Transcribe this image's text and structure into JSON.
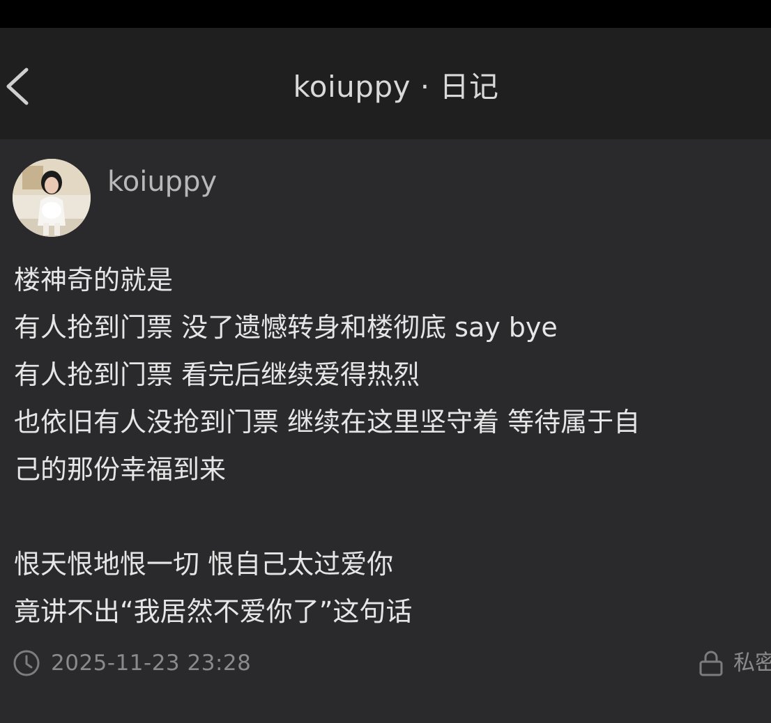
{
  "header": {
    "title": "koiuppy · 日记",
    "back_icon": "chevron-left-icon"
  },
  "author": {
    "name": "koiuppy",
    "avatar_icon": "user-avatar"
  },
  "diary": {
    "lines": [
      "楼神奇的就是",
      "有人抢到门票 没了遗憾转身和楼彻底 say bye",
      "有人抢到门票 看完后继续爱得热烈",
      "也依旧有人没抢到门票 继续在这里坚守着 等待属于自",
      "己的那份幸福到来",
      "",
      "恨天恨地恨一切 恨自己太过爱你",
      "竟讲不出“我居然不爱你了”这句话"
    ]
  },
  "meta": {
    "timestamp": "2025-11-23 23:28",
    "privacy_label": "私密",
    "clock_icon": "clock-icon",
    "lock_icon": "lock-icon"
  },
  "colors": {
    "background": "#2a2a2c",
    "nav_background": "#1f1f1f",
    "status_bar": "#000000",
    "primary_text": "#e6e6e6",
    "secondary_text": "#8a8a8a"
  }
}
